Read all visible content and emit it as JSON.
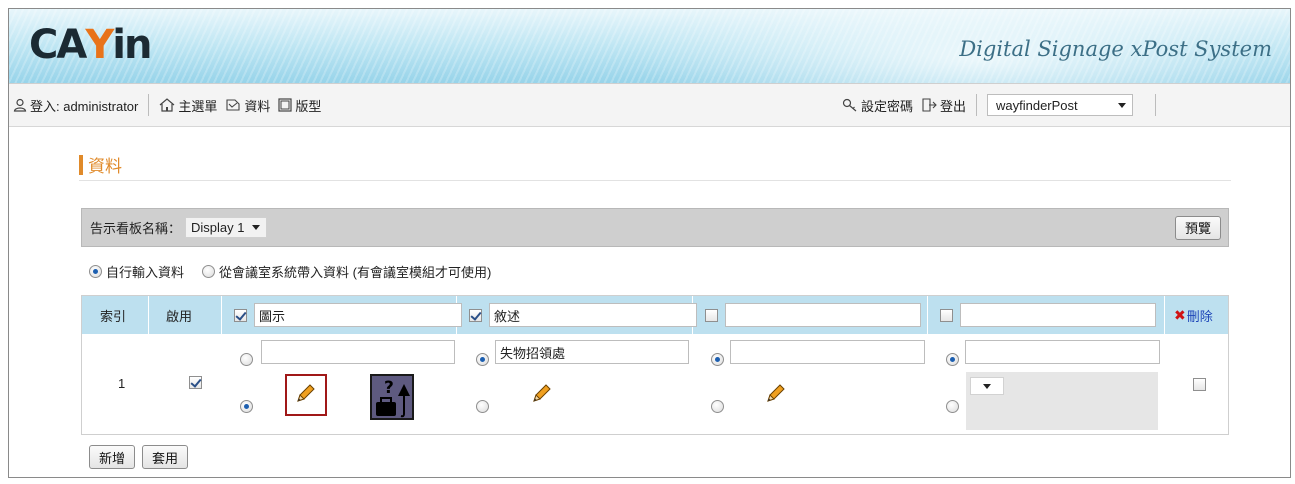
{
  "header": {
    "logo_text": "CAYIN",
    "tagline": "Digital Signage xPost System"
  },
  "nav": {
    "login_label": "登入: administrator",
    "main_menu": "主選單",
    "data": "資料",
    "template": "版型",
    "set_password": "設定密碼",
    "logout": "登出",
    "site_select": "wayfinderPost"
  },
  "section": {
    "title": "資料"
  },
  "display": {
    "label": "告示看板名稱：",
    "value": "Display 1",
    "preview_button": "預覽"
  },
  "source": {
    "option_manual": "自行輸入資料",
    "option_meeting": "從會議室系統帶入資料 (有會議室模組才可使用)",
    "selected": "manual"
  },
  "table": {
    "headers": {
      "index": "索引",
      "enable": "啟用",
      "col1_title": "圖示",
      "col2_title": "敘述",
      "col3_title": "",
      "col4_title": "",
      "delete": "刪除"
    },
    "rows": [
      {
        "index": "1",
        "enabled": true,
        "col1_text": "",
        "col2_text": "失物招領處",
        "col3_text": "",
        "col4_text": ""
      }
    ]
  },
  "actions": {
    "add": "新增",
    "apply": "套用"
  },
  "colors": {
    "accent": "#e08a2a",
    "header_blue": "#bde0ef",
    "delete_red": "#d01414",
    "highlight": "#a01818"
  }
}
